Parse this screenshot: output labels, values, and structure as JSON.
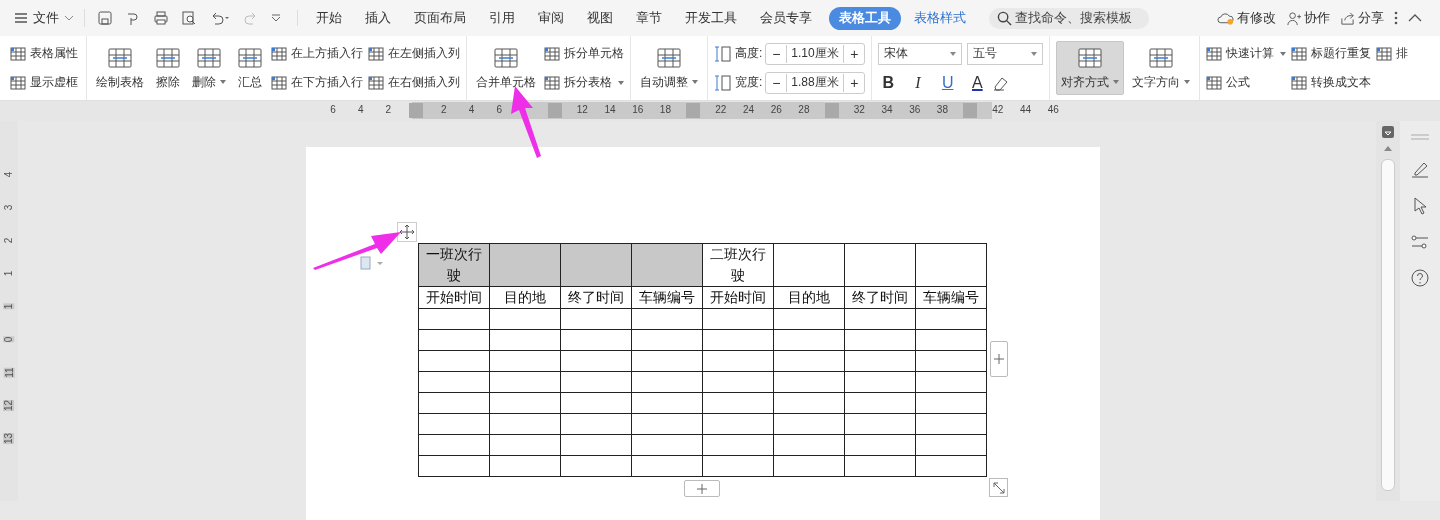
{
  "menu_bar": {
    "file_label": "文件",
    "tabs": [
      {
        "label": "开始",
        "selected": false
      },
      {
        "label": "插入",
        "selected": false
      },
      {
        "label": "页面布局",
        "selected": false
      },
      {
        "label": "引用",
        "selected": false
      },
      {
        "label": "审阅",
        "selected": false
      },
      {
        "label": "视图",
        "selected": false
      },
      {
        "label": "章节",
        "selected": false
      },
      {
        "label": "开发工具",
        "selected": false
      },
      {
        "label": "会员专享",
        "selected": false
      },
      {
        "label": "表格工具",
        "selected": true
      },
      {
        "label": "表格样式",
        "selected": false
      }
    ],
    "search": {
      "placeholder": "查找命令、搜索模板"
    },
    "actions": [
      "有修改",
      "协作",
      "分享"
    ]
  },
  "ribbon": {
    "groups": [
      {
        "items": [
          {
            "kind": "small",
            "label": "表格属性",
            "dropdown": false
          },
          {
            "kind": "small",
            "label": "显示虚框",
            "dropdown": false
          }
        ]
      },
      {
        "items": [
          {
            "kind": "large",
            "label": "绘制表格",
            "dropdown": false
          },
          {
            "kind": "large",
            "label": "擦除",
            "dropdown": false
          },
          {
            "kind": "large",
            "label": "删除",
            "dropdown": true
          },
          {
            "kind": "large",
            "label": "汇总",
            "dropdown": false
          },
          {
            "kind": "small",
            "label": "在上方插入行",
            "dropdown": false
          },
          {
            "kind": "small",
            "label": "在下方插入行",
            "dropdown": false
          },
          {
            "kind": "small",
            "label": "在左侧插入列",
            "dropdown": false
          },
          {
            "kind": "small",
            "label": "在右侧插入列",
            "dropdown": false
          }
        ]
      },
      {
        "items": [
          {
            "kind": "large",
            "label": "合并单元格",
            "dropdown": false
          },
          {
            "kind": "small",
            "label": "拆分单元格",
            "dropdown": false
          },
          {
            "kind": "small",
            "label": "拆分表格",
            "dropdown": true
          }
        ]
      },
      {
        "items": [
          {
            "kind": "large",
            "label": "自动调整",
            "dropdown": true
          }
        ]
      },
      {
        "items": [
          {
            "kind": "spin",
            "label": "高度:",
            "value": "1.10厘米",
            "decrement": "−",
            "increment": "+"
          },
          {
            "kind": "spin",
            "label": "宽度:",
            "value": "1.88厘米",
            "decrement": "−",
            "increment": "+"
          }
        ]
      },
      {
        "items": [
          {
            "kind": "select",
            "value": "宋体"
          },
          {
            "kind": "select",
            "value": "五号"
          },
          {
            "kind": "format",
            "label": "B"
          },
          {
            "kind": "format",
            "label": "I"
          },
          {
            "kind": "format",
            "label": "U"
          },
          {
            "kind": "format",
            "label": "A"
          },
          {
            "kind": "eraser"
          }
        ]
      },
      {
        "items": [
          {
            "kind": "large",
            "label": "对齐方式",
            "dropdown": true,
            "selected": true
          },
          {
            "kind": "large",
            "label": "文字方向",
            "dropdown": true,
            "selected": false
          }
        ]
      },
      {
        "items": [
          {
            "kind": "small",
            "label": "快速计算",
            "dropdown": true
          },
          {
            "kind": "small",
            "label": "公式",
            "dropdown": false
          },
          {
            "kind": "small",
            "label": "标题行重复",
            "dropdown": false
          },
          {
            "kind": "small",
            "label": "转换成文本",
            "dropdown": false
          },
          {
            "kind": "small",
            "label": "排",
            "dropdown": false
          }
        ]
      }
    ]
  },
  "ruler": {
    "labels": [
      "6",
      "4",
      "2",
      "2",
      "4",
      "6",
      "12",
      "14",
      "16",
      "18",
      "22",
      "24",
      "26",
      "28",
      "32",
      "34",
      "36",
      "38",
      "42",
      "44",
      "46"
    ]
  },
  "vertical_ruler": {
    "labels": [
      "4",
      "3",
      "2",
      "1",
      "1",
      "0",
      "11",
      "12",
      "13"
    ]
  },
  "table": {
    "rows": [
      [
        {
          "text": "一班次行驶",
          "shaded": true
        },
        {
          "text": "",
          "shaded": true
        },
        {
          "text": "",
          "shaded": true
        },
        {
          "text": "",
          "shaded": true
        },
        {
          "text": "二班次行驶",
          "shaded": false
        },
        {
          "text": "",
          "shaded": false
        },
        {
          "text": "",
          "shaded": false
        },
        {
          "text": "",
          "shaded": false
        }
      ],
      [
        {
          "text": "开始时间",
          "shaded": false
        },
        {
          "text": "目的地",
          "shaded": false
        },
        {
          "text": "终了时间",
          "shaded": false
        },
        {
          "text": "车辆编号",
          "shaded": false
        },
        {
          "text": "开始时间",
          "shaded": false
        },
        {
          "text": "目的地",
          "shaded": false
        },
        {
          "text": "终了时间",
          "shaded": false
        },
        {
          "text": "车辆编号",
          "shaded": false
        }
      ]
    ]
  }
}
